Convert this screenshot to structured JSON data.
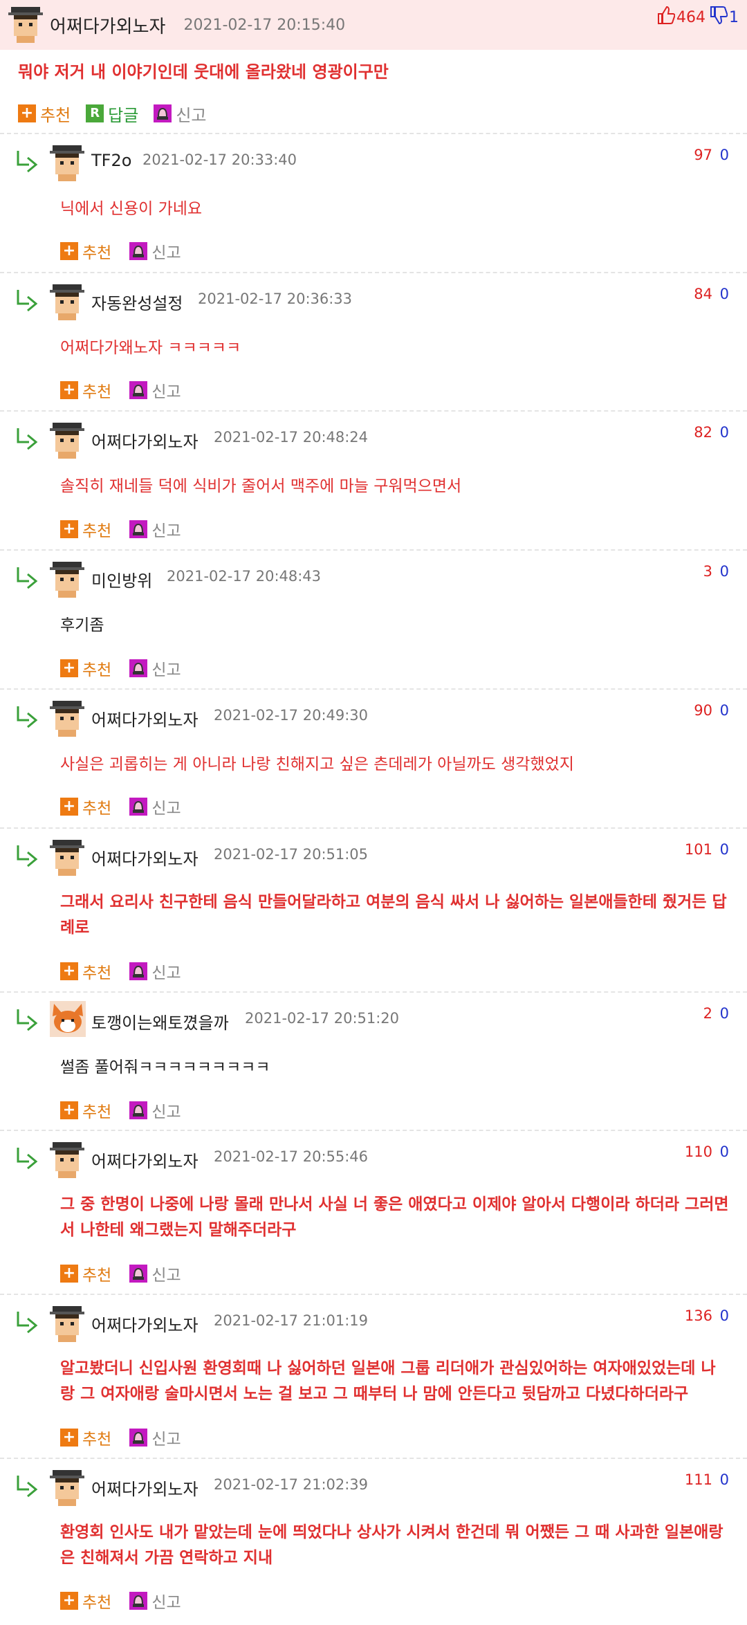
{
  "colors": {
    "header_bg": "#fde9e9",
    "recommend": "#ee7a12",
    "reply_badge": "#4aa83a",
    "report_badge": "#c31ac0",
    "upvote": "#dd2222",
    "downvote": "#2233cc",
    "highlight_text": "#e03030"
  },
  "main_comment": {
    "nickname": "어쩌다가외노자",
    "date": "2021-02-17 20:15:40",
    "upvotes": "464",
    "downvotes": "1",
    "text": "뭐야 저거 내 이야기인데 웃대에 올라왔네 영광이구만",
    "actions": {
      "recommend": "추천",
      "reply": "답글",
      "report": "신고"
    }
  },
  "labels": {
    "recommend": "추천",
    "report": "신고"
  },
  "replies": [
    {
      "nickname": "TF2o",
      "date": "2021-02-17 20:33:40",
      "up": "97",
      "down": "0",
      "text": "닉에서 신용이 가네요",
      "avatar": "hat"
    },
    {
      "nickname": "자동완성설정",
      "date": "2021-02-17 20:36:33",
      "up": "84",
      "down": "0",
      "text": "어쩌다가왜노자 ㅋㅋㅋㅋㅋ",
      "avatar": "hat"
    },
    {
      "nickname": "어쩌다가외노자",
      "date": "2021-02-17 20:48:24",
      "up": "82",
      "down": "0",
      "text": "솔직히 재네들 덕에 식비가 줄어서 맥주에 마늘 구워먹으면서",
      "avatar": "hat"
    },
    {
      "nickname": "미인방위",
      "date": "2021-02-17 20:48:43",
      "up": "3",
      "down": "0",
      "text": "후기좀",
      "avatar": "hat"
    },
    {
      "nickname": "어쩌다가외노자",
      "date": "2021-02-17 20:49:30",
      "up": "90",
      "down": "0",
      "text": "사실은 괴롭히는 게 아니라 나랑 친해지고 싶은 츤데레가 아닐까도 생각했었지",
      "avatar": "hat"
    },
    {
      "nickname": "어쩌다가외노자",
      "date": "2021-02-17 20:51:05",
      "up": "101",
      "down": "0",
      "text": "그래서 요리사 친구한테 음식 만들어달라하고 여분의 음식 싸서 나 싫어하는 일본애들한테 줬거든 답례로",
      "avatar": "hat"
    },
    {
      "nickname": "토깽이는왜토꼈을까",
      "date": "2021-02-17 20:51:20",
      "up": "2",
      "down": "0",
      "text": "썰좀 풀어줘ㅋㅋㅋㅋㅋㅋㅋㅋㅋ",
      "avatar": "fox"
    },
    {
      "nickname": "어쩌다가외노자",
      "date": "2021-02-17 20:55:46",
      "up": "110",
      "down": "0",
      "text": "그 중 한명이 나중에 나랑 몰래 만나서 사실 너 좋은 애였다고 이제야 알아서 다행이라 하더라 그러면서 나한테 왜그랬는지 말해주더라구",
      "avatar": "hat"
    },
    {
      "nickname": "어쩌다가외노자",
      "date": "2021-02-17 21:01:19",
      "up": "136",
      "down": "0",
      "text": "알고봤더니 신입사원 환영회때 나 싫어하던 일본애 그룹 리더애가 관심있어하는 여자애있었는데 나랑 그 여자애랑 술마시면서 노는 걸 보고 그 때부터 나 맘에 안든다고 뒷담까고 다녔다하더라구",
      "avatar": "hat"
    },
    {
      "nickname": "어쩌다가외노자",
      "date": "2021-02-17 21:02:39",
      "up": "111",
      "down": "0",
      "text": "환영회 인사도 내가 맡았는데 눈에 띄었다나 상사가 시켜서 한건데 뭐 어쨌든 그 때 사과한 일본애랑은 친해져서 가끔 연락하고 지내",
      "avatar": "hat"
    }
  ]
}
